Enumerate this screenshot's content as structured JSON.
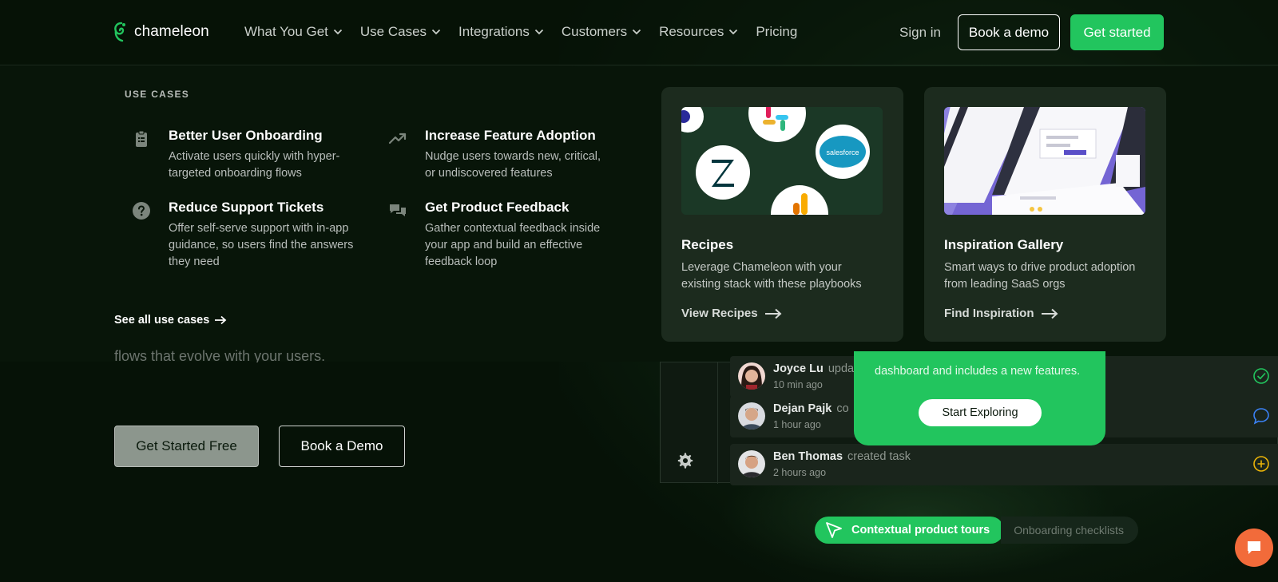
{
  "brand": {
    "name": "chameleon",
    "accent": "#22c55e",
    "background": "#061207"
  },
  "nav": {
    "items": [
      {
        "label": "What You Get",
        "has_dropdown": true
      },
      {
        "label": "Use Cases",
        "has_dropdown": true
      },
      {
        "label": "Integrations",
        "has_dropdown": true
      },
      {
        "label": "Customers",
        "has_dropdown": true
      },
      {
        "label": "Resources",
        "has_dropdown": true
      },
      {
        "label": "Pricing",
        "has_dropdown": false
      }
    ],
    "sign_in": "Sign in",
    "book_demo": "Book a demo",
    "get_started": "Get started"
  },
  "dropdown": {
    "section_label": "USE CASES",
    "items": [
      {
        "title": "Better User Onboarding",
        "description": "Activate users quickly with hyper-targeted onboarding flows",
        "icon": "clipboard-icon"
      },
      {
        "title": "Increase Feature Adoption",
        "description": "Nudge users towards new, critical, or undiscovered features",
        "icon": "trending-up-icon"
      },
      {
        "title": "Reduce Support Tickets",
        "description": "Offer self-serve support with in-app guidance, so users find the answers they need",
        "icon": "question-circle-icon"
      },
      {
        "title": "Get Product Feedback",
        "description": "Gather contextual feedback inside your app and build an effective feedback loop",
        "icon": "chat-bubbles-icon"
      }
    ],
    "see_all": "See all use cases",
    "cards": [
      {
        "title": "Recipes",
        "description": "Leverage Chameleon with your existing stack with these playbooks",
        "link": "View Recipes",
        "image_logo_text": "salesforce"
      },
      {
        "title": "Inspiration Gallery",
        "description": "Smart ways to drive product adoption from leading SaaS orgs",
        "link": "Find Inspiration"
      }
    ]
  },
  "hero": {
    "partial_text": "flows that evolve with your users.",
    "get_started_free": "Get Started Free",
    "book_a_demo": "Book a Demo"
  },
  "mockup": {
    "activity": [
      {
        "name": "Joyce Lu",
        "action": "upda",
        "time": "10 min ago",
        "icon": "check-circle-icon"
      },
      {
        "name": "Dejan Pajk",
        "action": "co",
        "time": "1 hour ago",
        "icon": "comment-icon"
      },
      {
        "name": "Ben Thomas",
        "action": "created task",
        "time": "2 hours ago",
        "icon": "plus-circle-icon"
      }
    ],
    "popup": {
      "text": "dashboard and includes a new features.",
      "button": "Start Exploring"
    }
  },
  "feature_pills": {
    "active": "Contextual product tours",
    "inactive": "Onboarding checklists"
  }
}
